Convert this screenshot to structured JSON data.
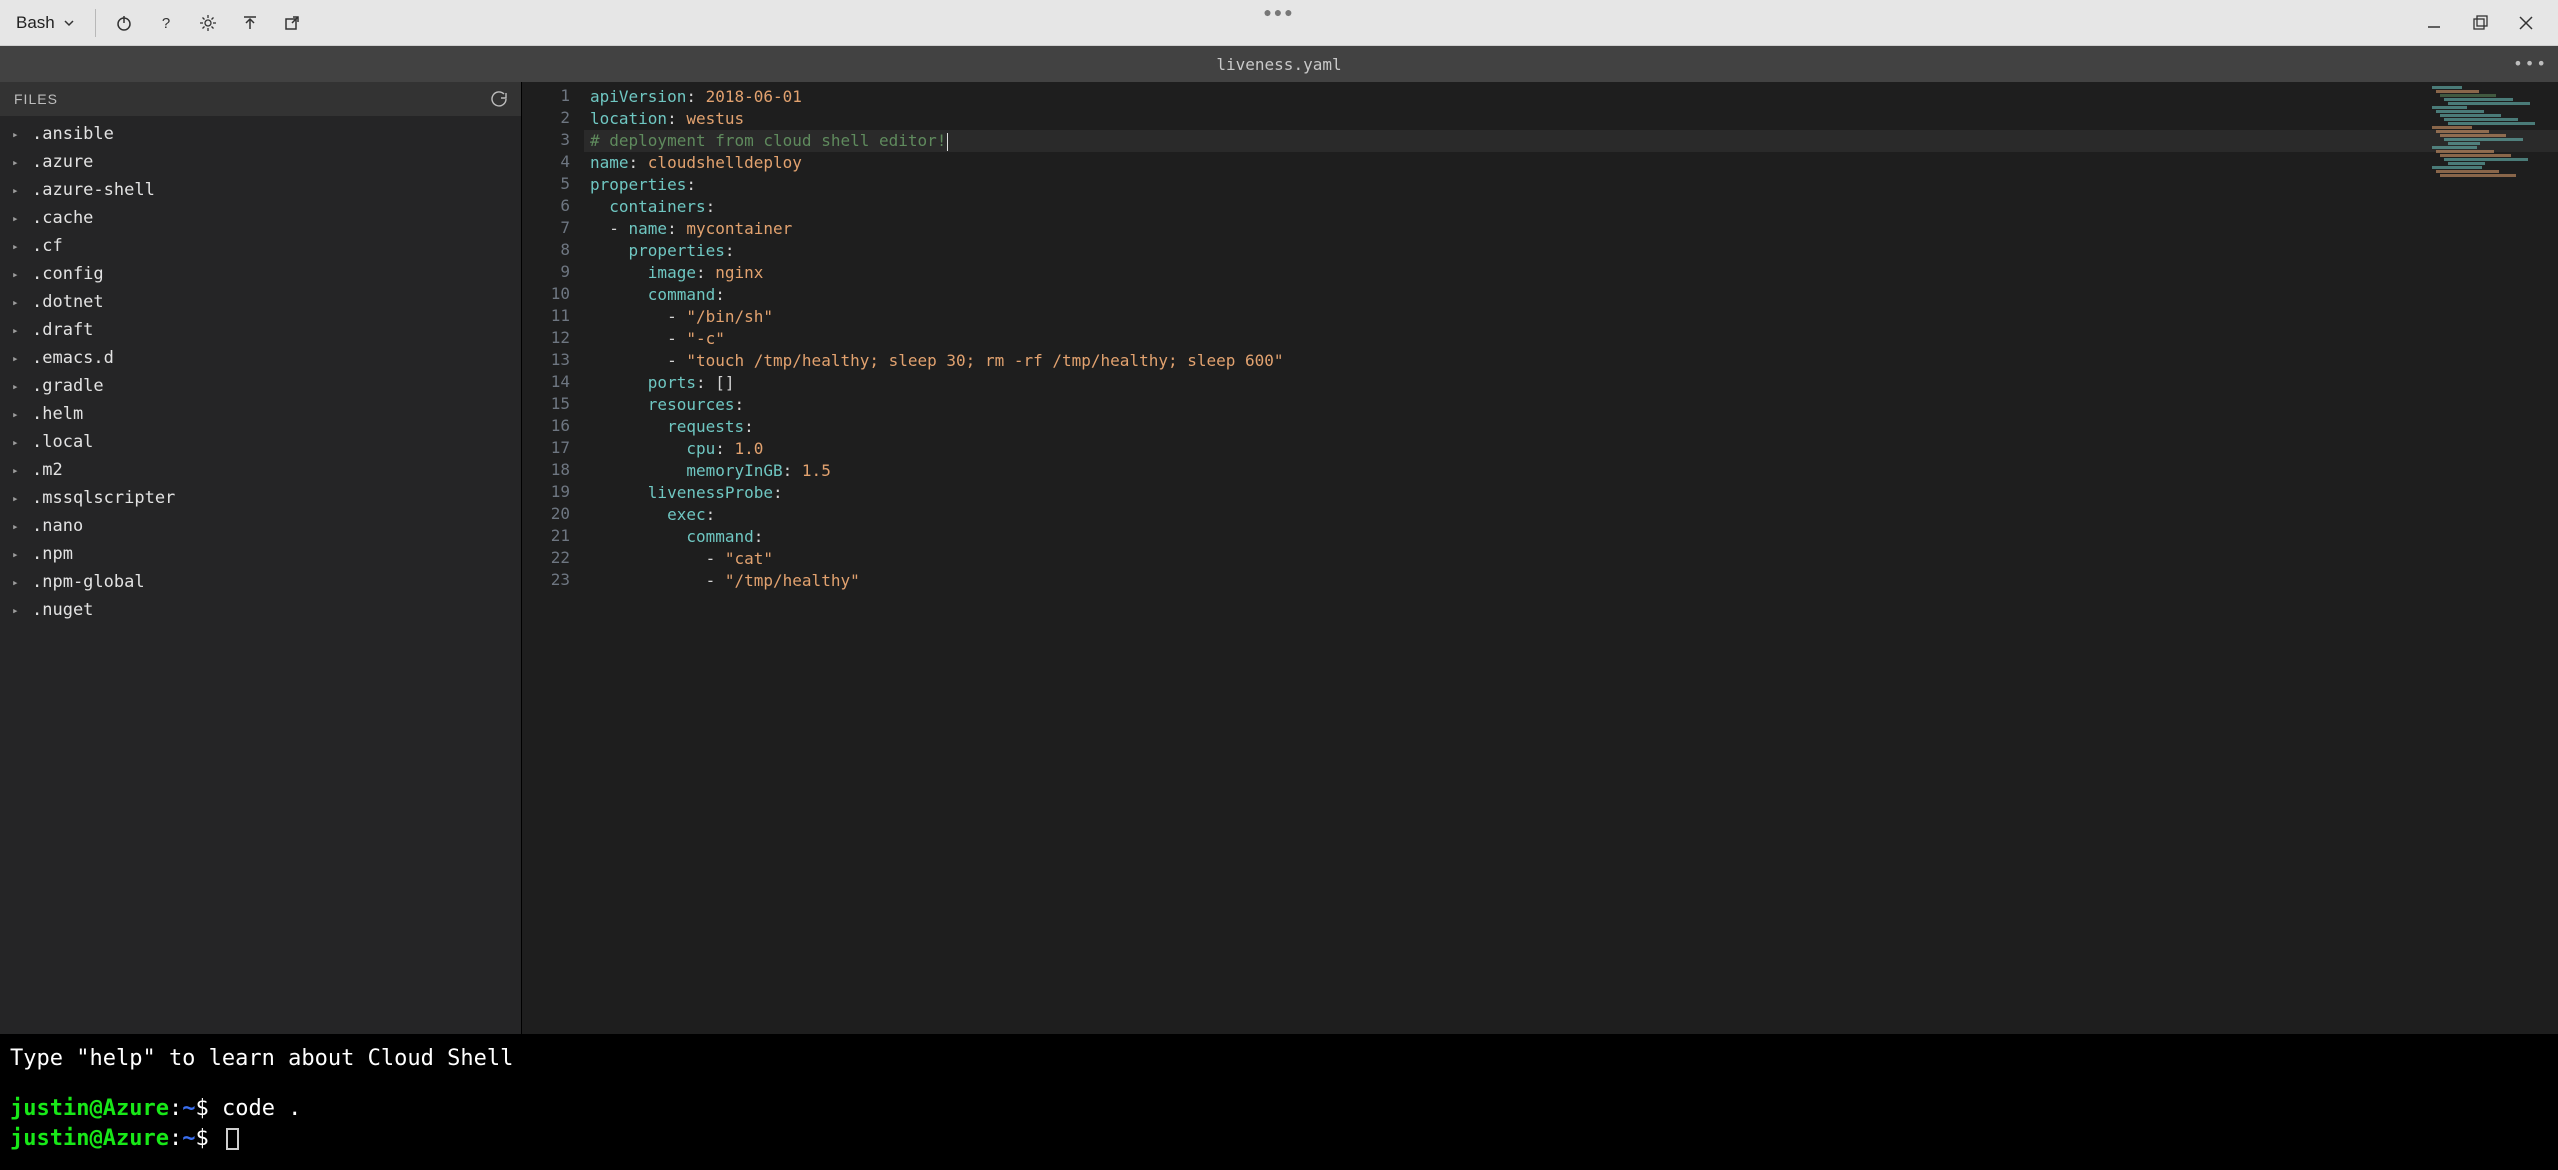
{
  "toolbar": {
    "shell_label": "Bash"
  },
  "tab": {
    "filename": "liveness.yaml"
  },
  "sidebar": {
    "title": "FILES",
    "items": [
      ".ansible",
      ".azure",
      ".azure-shell",
      ".cache",
      ".cf",
      ".config",
      ".dotnet",
      ".draft",
      ".emacs.d",
      ".gradle",
      ".helm",
      ".local",
      ".m2",
      ".mssqlscripter",
      ".nano",
      ".npm",
      ".npm-global",
      ".nuget"
    ]
  },
  "code": {
    "active_line": 3,
    "lines": [
      {
        "n": 1,
        "segs": [
          [
            "key",
            "apiVersion"
          ],
          [
            "punc",
            ": "
          ],
          [
            "val",
            "2018-06-01"
          ]
        ]
      },
      {
        "n": 2,
        "segs": [
          [
            "key",
            "location"
          ],
          [
            "punc",
            ": "
          ],
          [
            "val",
            "westus"
          ]
        ]
      },
      {
        "n": 3,
        "segs": [
          [
            "comment",
            "# deployment from cloud shell editor!"
          ]
        ],
        "cursor_after": true
      },
      {
        "n": 4,
        "segs": [
          [
            "key",
            "name"
          ],
          [
            "punc",
            ": "
          ],
          [
            "val",
            "cloudshelldeploy"
          ]
        ]
      },
      {
        "n": 5,
        "segs": [
          [
            "key",
            "properties"
          ],
          [
            "punc",
            ":"
          ]
        ]
      },
      {
        "n": 6,
        "segs": [
          [
            "indent",
            "  "
          ],
          [
            "key",
            "containers"
          ],
          [
            "punc",
            ":"
          ]
        ]
      },
      {
        "n": 7,
        "segs": [
          [
            "indent",
            "  "
          ],
          [
            "dash",
            "- "
          ],
          [
            "key",
            "name"
          ],
          [
            "punc",
            ": "
          ],
          [
            "val",
            "mycontainer"
          ]
        ]
      },
      {
        "n": 8,
        "segs": [
          [
            "indent",
            "    "
          ],
          [
            "key",
            "properties"
          ],
          [
            "punc",
            ":"
          ]
        ]
      },
      {
        "n": 9,
        "segs": [
          [
            "indent",
            "      "
          ],
          [
            "key",
            "image"
          ],
          [
            "punc",
            ": "
          ],
          [
            "val",
            "nginx"
          ]
        ]
      },
      {
        "n": 10,
        "segs": [
          [
            "indent",
            "      "
          ],
          [
            "key",
            "command"
          ],
          [
            "punc",
            ":"
          ]
        ]
      },
      {
        "n": 11,
        "segs": [
          [
            "indent",
            "        "
          ],
          [
            "dash",
            "- "
          ],
          [
            "str",
            "\"/bin/sh\""
          ]
        ]
      },
      {
        "n": 12,
        "segs": [
          [
            "indent",
            "        "
          ],
          [
            "dash",
            "- "
          ],
          [
            "str",
            "\"-c\""
          ]
        ]
      },
      {
        "n": 13,
        "segs": [
          [
            "indent",
            "        "
          ],
          [
            "dash",
            "- "
          ],
          [
            "str",
            "\"touch /tmp/healthy; sleep 30; rm -rf /tmp/healthy; sleep 600\""
          ]
        ]
      },
      {
        "n": 14,
        "segs": [
          [
            "indent",
            "      "
          ],
          [
            "key",
            "ports"
          ],
          [
            "punc",
            ": "
          ],
          [
            "brackets",
            "[]"
          ]
        ]
      },
      {
        "n": 15,
        "segs": [
          [
            "indent",
            "      "
          ],
          [
            "key",
            "resources"
          ],
          [
            "punc",
            ":"
          ]
        ]
      },
      {
        "n": 16,
        "segs": [
          [
            "indent",
            "        "
          ],
          [
            "key",
            "requests"
          ],
          [
            "punc",
            ":"
          ]
        ]
      },
      {
        "n": 17,
        "segs": [
          [
            "indent",
            "          "
          ],
          [
            "key",
            "cpu"
          ],
          [
            "punc",
            ": "
          ],
          [
            "num",
            "1.0"
          ]
        ]
      },
      {
        "n": 18,
        "segs": [
          [
            "indent",
            "          "
          ],
          [
            "key",
            "memoryInGB"
          ],
          [
            "punc",
            ": "
          ],
          [
            "num",
            "1.5"
          ]
        ]
      },
      {
        "n": 19,
        "segs": [
          [
            "indent",
            "      "
          ],
          [
            "key",
            "livenessProbe"
          ],
          [
            "punc",
            ":"
          ]
        ]
      },
      {
        "n": 20,
        "segs": [
          [
            "indent",
            "        "
          ],
          [
            "key",
            "exec"
          ],
          [
            "punc",
            ":"
          ]
        ]
      },
      {
        "n": 21,
        "segs": [
          [
            "indent",
            "          "
          ],
          [
            "key",
            "command"
          ],
          [
            "punc",
            ":"
          ]
        ]
      },
      {
        "n": 22,
        "segs": [
          [
            "indent",
            "            "
          ],
          [
            "dash",
            "- "
          ],
          [
            "str",
            "\"cat\""
          ]
        ]
      },
      {
        "n": 23,
        "segs": [
          [
            "indent",
            "            "
          ],
          [
            "dash",
            "- "
          ],
          [
            "str",
            "\"/tmp/healthy\""
          ]
        ]
      }
    ]
  },
  "terminal": {
    "intro": "Type \"help\" to learn about Cloud Shell",
    "user": "justin",
    "host": "Azure",
    "path": "~",
    "prompt_symbol": "$",
    "lines": [
      {
        "cmd": "code ."
      },
      {
        "cmd": ""
      }
    ]
  }
}
